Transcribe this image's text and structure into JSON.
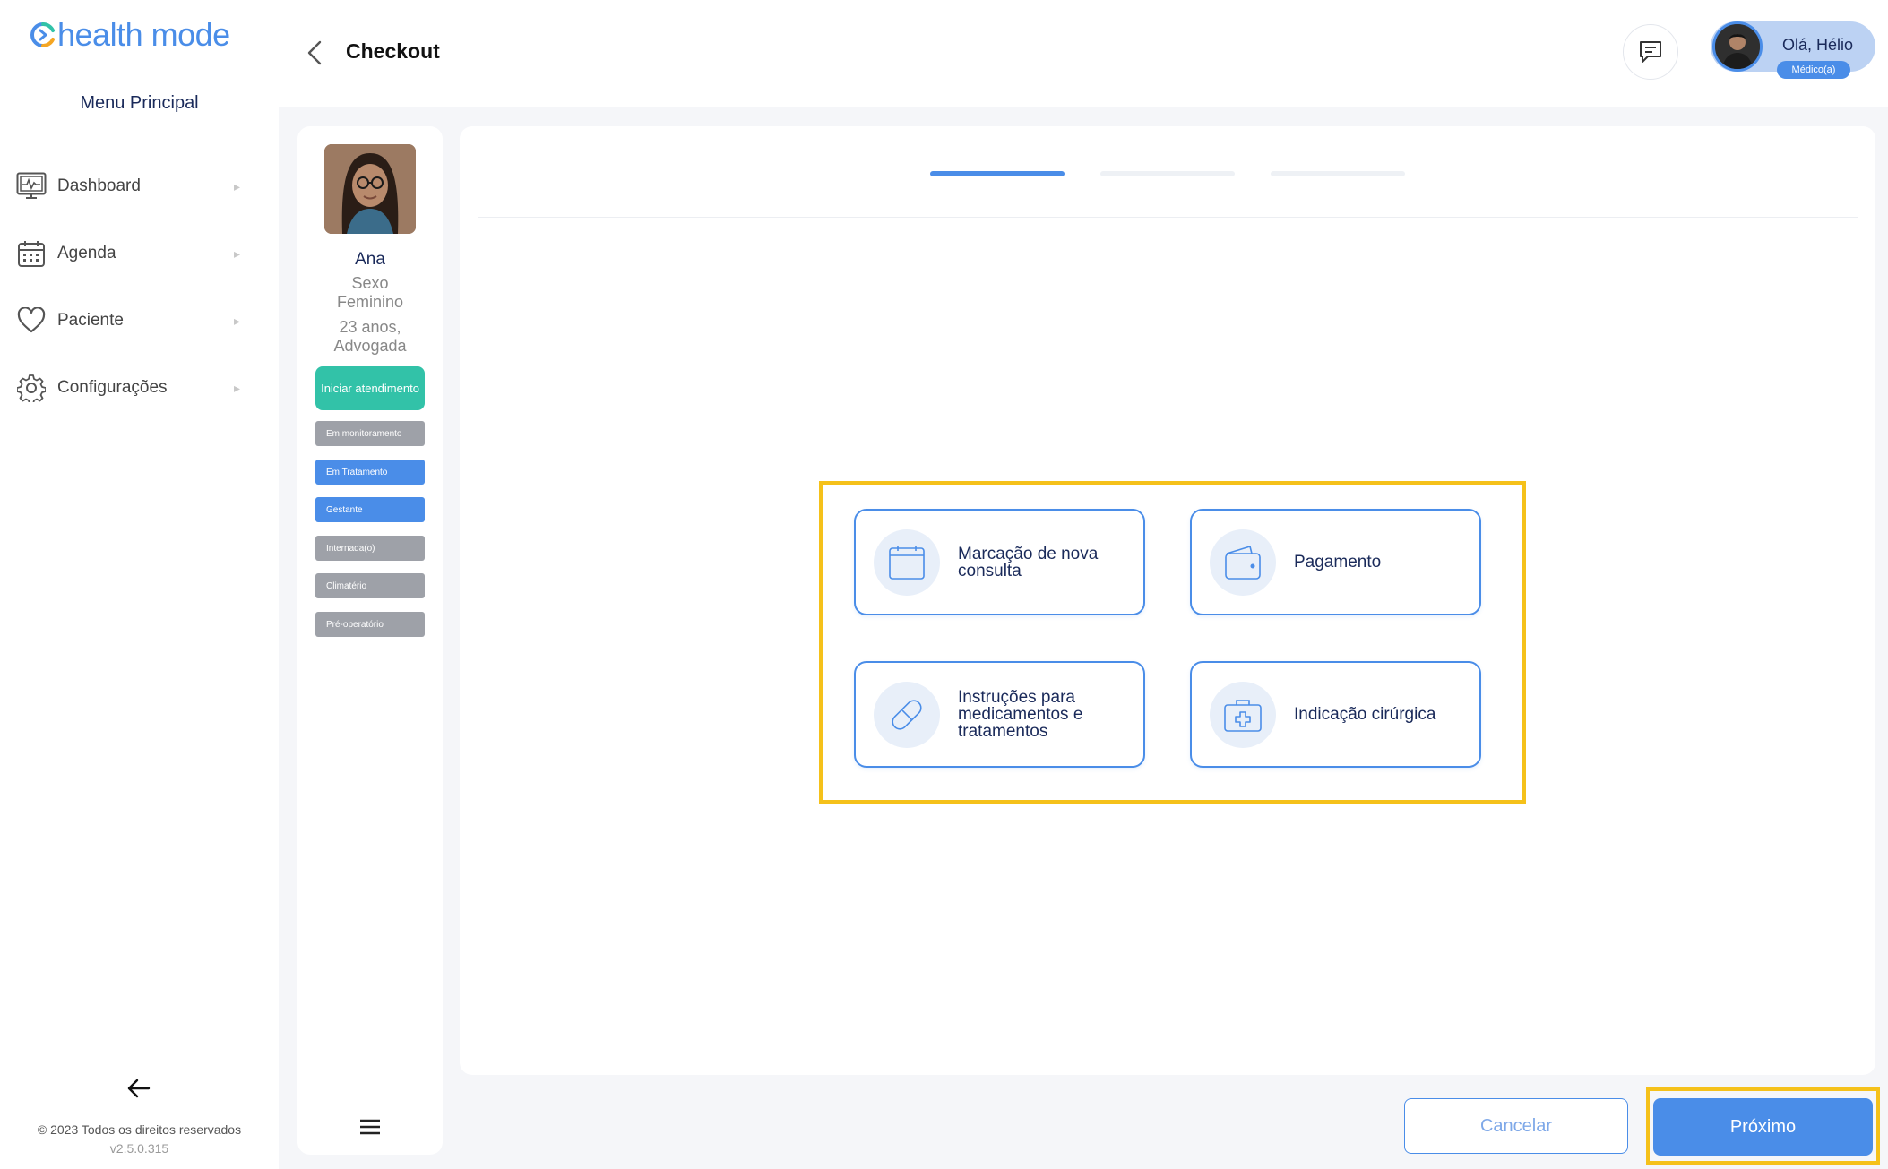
{
  "app": {
    "logo_text": "health mode"
  },
  "sidebar": {
    "menu_title": "Menu Principal",
    "items": [
      {
        "label": "Dashboard",
        "icon": "monitor-icon"
      },
      {
        "label": "Agenda",
        "icon": "calendar-icon"
      },
      {
        "label": "Paciente",
        "icon": "heart-icon"
      },
      {
        "label": "Configurações",
        "icon": "gear-icon"
      }
    ],
    "copyright": "© 2023 Todos os direitos reservados",
    "version": "v2.5.0.315"
  },
  "header": {
    "title": "Checkout",
    "greeting": "Olá, Hélio",
    "role": "Médico(a)"
  },
  "patient": {
    "name": "Ana",
    "sex_line1": "Sexo",
    "sex_line2": "Feminino",
    "age_line1": "23 anos,",
    "age_line2": "Advogada",
    "start_button": "Iniciar atendimento",
    "tags": [
      {
        "label": "Em monitoramento",
        "color": "#9ea1a8"
      },
      {
        "label": "Em Tratamento",
        "color": "#4a8de8"
      },
      {
        "label": "Gestante",
        "color": "#4a8de8"
      },
      {
        "label": "Internada(o)",
        "color": "#9ea1a8"
      },
      {
        "label": "Climatério",
        "color": "#9ea1a8"
      },
      {
        "label": "Pré-operatório",
        "color": "#9ea1a8"
      }
    ]
  },
  "steps": {
    "total": 3,
    "active": 1
  },
  "options": [
    {
      "label": "Marcação de nova consulta",
      "icon": "calendar-icon"
    },
    {
      "label": "Pagamento",
      "icon": "wallet-icon"
    },
    {
      "label": "Instruções para medicamentos e tratamentos",
      "icon": "pill-icon"
    },
    {
      "label": "Indicação cirúrgica",
      "icon": "medical-kit-icon"
    }
  ],
  "footer": {
    "cancel_label": "Cancelar",
    "next_label": "Próximo"
  }
}
